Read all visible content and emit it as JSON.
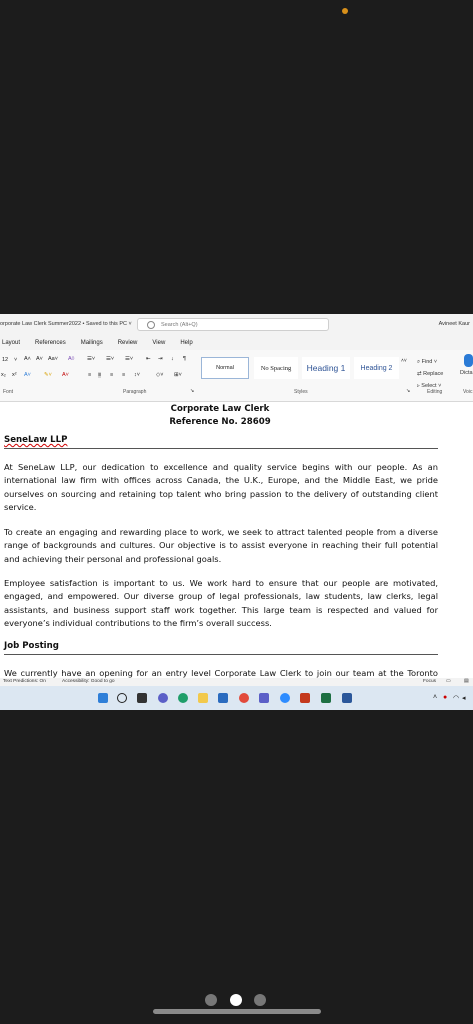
{
  "window": {
    "title": "orporate Law Clerk Summer2022 • Saved to this PC ˅",
    "search_placeholder": "Search (Alt+Q)",
    "user": "Avineet Kaur"
  },
  "menu": [
    "Layout",
    "References",
    "Mailings",
    "Review",
    "View",
    "Help"
  ],
  "ribbon": {
    "font_size": "12",
    "groups": [
      "Font",
      "Paragraph",
      "Styles",
      "Editing",
      "Voic"
    ],
    "styles": [
      "Normal",
      "No Spacing",
      "Heading 1",
      "Heading 2"
    ],
    "editing": [
      "Find",
      "Replace",
      "Select"
    ],
    "dictate": "Dicta"
  },
  "document": {
    "title": "Corporate Law Clerk",
    "reference": "Reference No. 28609",
    "company_heading": "SeneLaw LLP",
    "paragraphs": [
      "At SeneLaw LLP, our dedication to excellence and quality service begins with our people. As an international law firm with offices across Canada, the U.K., Europe, and the Middle East, we pride ourselves on sourcing and retaining top talent who bring passion to the delivery of outstanding client service.",
      "To create an engaging and rewarding place to work, we seek to attract talented people from a diverse range of backgrounds and cultures. Our objective is to assist everyone in reaching their full potential and achieving their personal and professional goals.",
      "Employee satisfaction is important to us. We work hard to ensure that our people are motivated, engaged, and empowered. Our diverse group of legal professionals, law students, law clerks, legal assistants, and business support staff work together.  This large team is respected and valued for everyone’s individual contributions to the firm’s overall success."
    ],
    "job_heading": "Job Posting",
    "job_paragraph": "We currently have an opening for an entry level Corporate Law Clerk to join our team at the Toronto office. Reporting to a senior partner, you will support the Corporate Department by"
  },
  "status": {
    "predictions": "Text Predictions: On",
    "accessibility": "Accessibility: Good to go",
    "focus": "Focus"
  },
  "colors": {
    "accent": "#2b579a",
    "heading_blue": "#2f5496",
    "taskbar": "#dce7f2"
  }
}
